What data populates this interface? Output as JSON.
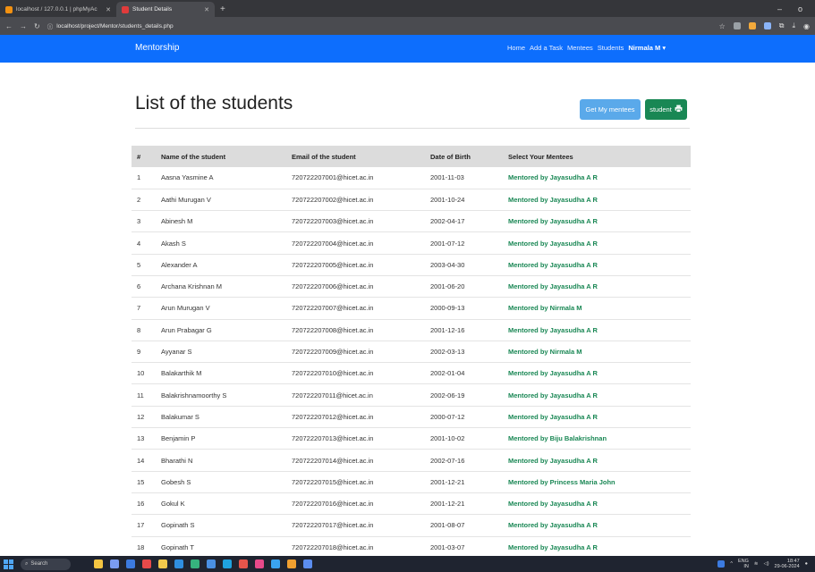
{
  "browser": {
    "tabs": [
      {
        "label": "localhost / 127.0.0.1 | phpMyAc",
        "active": false,
        "favicon_color": "#f29111"
      },
      {
        "label": "Student Details",
        "active": true,
        "favicon_color": "#e03b3b"
      }
    ],
    "new_tab_label": "+",
    "url": "localhost/project/Mentor/students_details.php",
    "window_controls": {
      "minimize": "–",
      "maximize": "o"
    }
  },
  "navbar": {
    "brand": "Mentorship",
    "links": [
      "Home",
      "Add a Task",
      "Mentees",
      "Students"
    ],
    "user": "Nirmala M",
    "user_caret": "▾",
    "bg_color": "#0d6efd"
  },
  "page": {
    "title": "List of the students",
    "get_mentees_button": "Get My mentees",
    "student_button": "student",
    "student_button_icon": "printer-icon"
  },
  "table": {
    "headers": [
      "#",
      "Name of the student",
      "Email of the student",
      "Date of Birth",
      "Select Your Mentees"
    ],
    "rows": [
      [
        "1",
        "Aasna Yasmine A",
        "720722207001@hicet.ac.in",
        "2001-11-03",
        "Mentored by Jayasudha A R"
      ],
      [
        "2",
        "Aathi Murugan V",
        "720722207002@hicet.ac.in",
        "2001-10-24",
        "Mentored by Jayasudha A R"
      ],
      [
        "3",
        "Abinesh M",
        "720722207003@hicet.ac.in",
        "2002-04-17",
        "Mentored by Jayasudha A R"
      ],
      [
        "4",
        "Akash S",
        "720722207004@hicet.ac.in",
        "2001-07-12",
        "Mentored by Jayasudha A R"
      ],
      [
        "5",
        "Alexander A",
        "720722207005@hicet.ac.in",
        "2003-04-30",
        "Mentored by Jayasudha A R"
      ],
      [
        "6",
        "Archana Krishnan M",
        "720722207006@hicet.ac.in",
        "2001-06-20",
        "Mentored by Jayasudha A R"
      ],
      [
        "7",
        "Arun Murugan V",
        "720722207007@hicet.ac.in",
        "2000-09-13",
        "Mentored by Nirmala M"
      ],
      [
        "8",
        "Arun Prabagar G",
        "720722207008@hicet.ac.in",
        "2001-12-16",
        "Mentored by Jayasudha A R"
      ],
      [
        "9",
        "Ayyanar S",
        "720722207009@hicet.ac.in",
        "2002-03-13",
        "Mentored by Nirmala M"
      ],
      [
        "10",
        "Balakarthik M",
        "720722207010@hicet.ac.in",
        "2002-01-04",
        "Mentored by Jayasudha A R"
      ],
      [
        "11",
        "Balakrishnamoorthy S",
        "720722207011@hicet.ac.in",
        "2002-06-19",
        "Mentored by Jayasudha A R"
      ],
      [
        "12",
        "Balakumar S",
        "720722207012@hicet.ac.in",
        "2000-07-12",
        "Mentored by Jayasudha A R"
      ],
      [
        "13",
        "Benjamin P",
        "720722207013@hicet.ac.in",
        "2001-10-02",
        "Mentored by Biju Balakrishnan"
      ],
      [
        "14",
        "Bharathi N",
        "720722207014@hicet.ac.in",
        "2002-07-16",
        "Mentored by Jayasudha A R"
      ],
      [
        "15",
        "Gobesh S",
        "720722207015@hicet.ac.in",
        "2001-12-21",
        "Mentored by Princess Maria John"
      ],
      [
        "16",
        "Gokul K",
        "720722207016@hicet.ac.in",
        "2001-12-21",
        "Mentored by Jayasudha A R"
      ],
      [
        "17",
        "Gopinath S",
        "720722207017@hicet.ac.in",
        "2001-08-07",
        "Mentored by Jayasudha A R"
      ],
      [
        "18",
        "Gopinath T",
        "720722207018@hicet.ac.in",
        "2001-03-07",
        "Mentored by Jayasudha A R"
      ]
    ],
    "mentor_color": "#198754"
  },
  "taskbar": {
    "search_label": "Search",
    "tray_lang": "ENG",
    "tray_region": "IN",
    "time": "18:47",
    "date": "29-06-2024"
  }
}
